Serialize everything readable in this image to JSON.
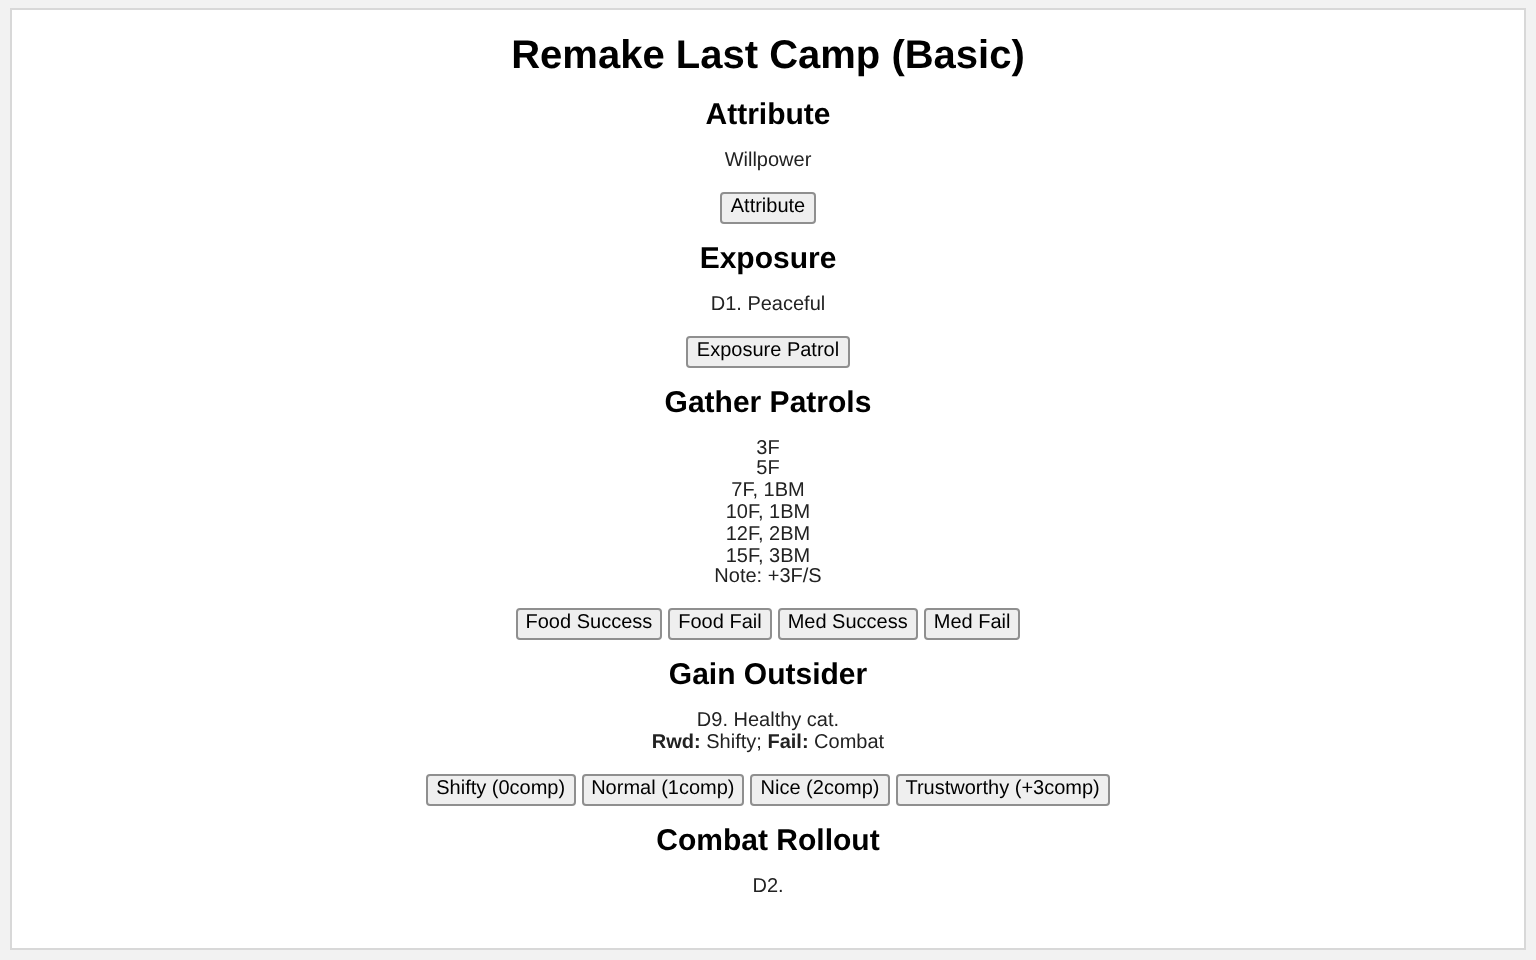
{
  "title": "Remake Last Camp (Basic)",
  "sections": [
    {
      "heading": "Attribute",
      "lines": [
        "Willpower"
      ],
      "buttons": [
        "Attribute"
      ]
    },
    {
      "heading": "Exposure",
      "lines": [
        "D1. Peaceful"
      ],
      "buttons": [
        "Exposure Patrol"
      ]
    },
    {
      "heading": "Gather Patrols",
      "lines": [
        "3F",
        "5F",
        "7F, 1BM",
        "10F, 1BM",
        "12F, 2BM",
        "15F, 3BM",
        "Note: +3F/S"
      ],
      "buttons": [
        "Food Success",
        "Food Fail",
        "Med Success",
        "Med Fail"
      ]
    },
    {
      "heading": "Gain Outsider",
      "lines": [
        "D9. Healthy cat.",
        "**Rwd:** Shifty; **Fail:** Combat"
      ],
      "buttons": [
        "Shifty (0comp)",
        "Normal (1comp)",
        "Nice (2comp)",
        "Trustworthy (+3comp)"
      ]
    },
    {
      "heading": "Combat Rollout",
      "lines": [
        "D2."
      ]
    }
  ]
}
